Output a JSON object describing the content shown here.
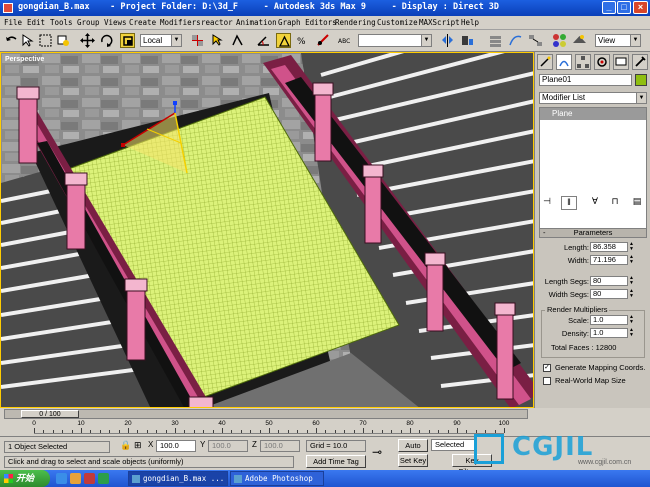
{
  "window": {
    "title": "gongdian_B.max    - Project Folder: D:\\3d_F     - Autodesk 3ds Max 9     - Display : Direct 3D"
  },
  "menu": [
    "File",
    "Edit",
    "Tools",
    "Group",
    "Views",
    "Create",
    "Modifiers",
    "reactor",
    "Animation",
    "Graph Editors",
    "Rendering",
    "Customize",
    "MAXScript",
    "Help"
  ],
  "toolbar": {
    "coord_system": "Local",
    "selection_set": "",
    "viewport_select": "View"
  },
  "viewport": {
    "label": "Perspective"
  },
  "command_panel": {
    "object_name": "Plane01",
    "object_color": "#8fbf10",
    "modifier_list": "Modifier List",
    "stack_items": [
      "Plane"
    ],
    "rollout_title": "Parameters",
    "length_label": "Length:",
    "length_value": "86.358",
    "width_label": "Width:",
    "width_value": "71.196",
    "length_segs_label": "Length Segs:",
    "length_segs_value": "80",
    "width_segs_label": "Width Segs:",
    "width_segs_value": "80",
    "render_mult_title": "Render Multipliers",
    "scale_label": "Scale:",
    "scale_value": "1.0",
    "density_label": "Density:",
    "density_value": "1.0",
    "total_faces": "Total Faces : 12800",
    "gen_mapping_label": "Generate Mapping Coords.",
    "gen_mapping_checked": true,
    "realworld_label": "Real-World Map Size",
    "realworld_checked": false
  },
  "timeline": {
    "frame_indicator": "0 / 100",
    "ticks": [
      "0",
      "10",
      "20",
      "30",
      "40",
      "50",
      "60",
      "70",
      "80",
      "90",
      "100"
    ]
  },
  "status": {
    "selection": "1 Object Selected",
    "prompt": "Click and drag to select and scale objects (uniformly)",
    "x_label": "X",
    "x_value": "100.0",
    "y_label": "Y",
    "y_value": "100.0",
    "z_label": "Z",
    "z_value": "100.0",
    "grid": "Grid = 10.0",
    "add_time_tag": "Add Time Tag",
    "auto_key": "Auto Key",
    "set_key": "Set Key",
    "key_mode": "Selected",
    "key_filters": "Key Filters..."
  },
  "taskbar": {
    "start": "开始",
    "tasks": [
      "gongdian_B.max ...",
      "Adobe Photoshop"
    ]
  },
  "watermark": {
    "big": "CGJIL",
    "small": "www.cgjil.com.cn"
  }
}
